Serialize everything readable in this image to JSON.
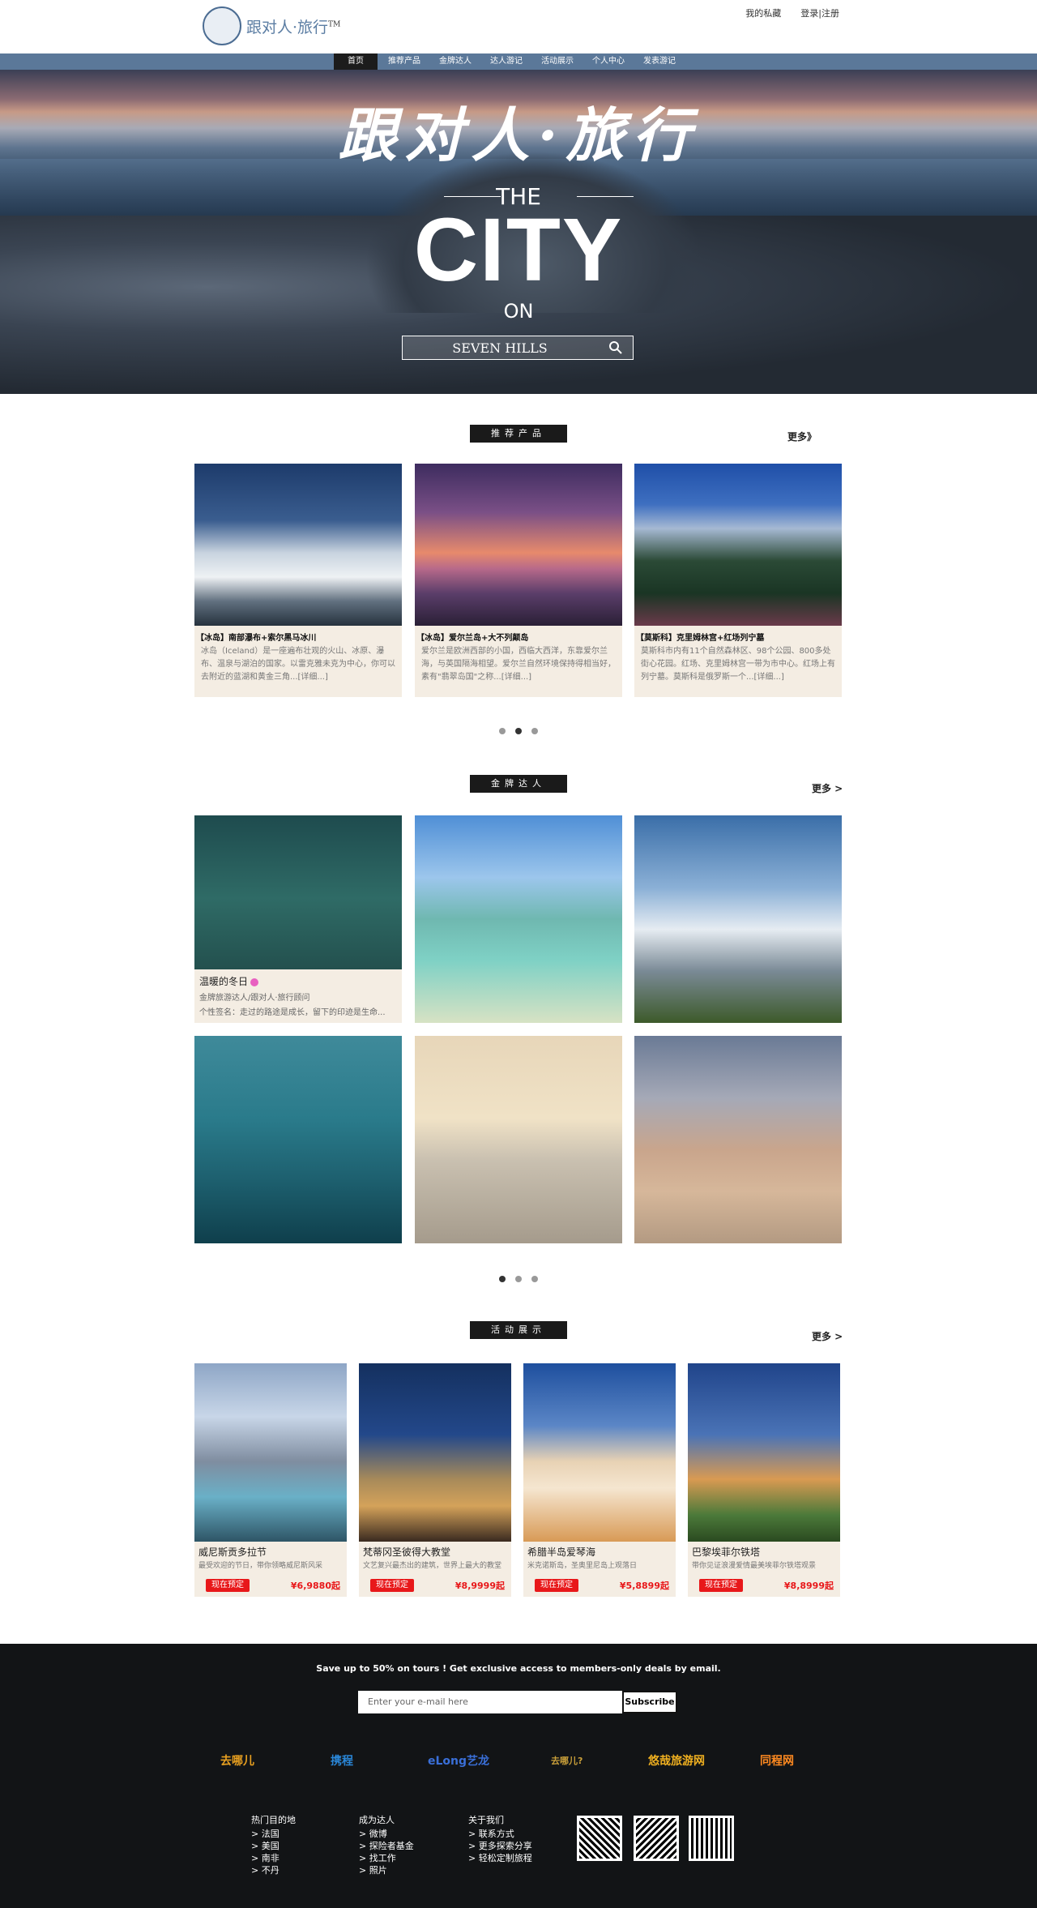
{
  "header": {
    "logo_text": "跟对人·旅行",
    "logo_tm": "TM",
    "links": [
      "我的私藏",
      "登录|注册"
    ]
  },
  "nav": [
    "首页",
    "推荐产品",
    "金牌达人",
    "达人游记",
    "活动展示",
    "个人中心",
    "发表游记"
  ],
  "hero": {
    "title": "跟对人·旅行",
    "the": "THE",
    "city": "CITY",
    "on": "ON",
    "search_text": "SEVEN HILLS"
  },
  "recommend": {
    "tag": "推荐产品",
    "more": "更多》",
    "cards": [
      {
        "title": "【冰岛】南部瀑布+索尔黑马冰川",
        "desc": "冰岛（Iceland）是一座遍布壮观的火山、冰原、瀑布、温泉与湖泊的国家。以雷克雅未克为中心，你可以去附近的蓝湖和黄金三角...[详细...]"
      },
      {
        "title": "【冰岛】爱尔兰岛+大不列颠岛",
        "desc": "爱尔兰是欧洲西部的小国，西临大西洋，东靠爱尔兰海，与英国隔海相望。爱尔兰自然环境保持得相当好，素有\"翡翠岛国\"之称...[详细...]"
      },
      {
        "title": "【莫斯科】克里姆林宫+红场列宁墓",
        "desc": "莫斯科市内有11个自然森林区、98个公园、800多处街心花园。红场、克里姆林宫一带为市中心。红场上有列宁墓。莫斯科是俄罗斯一个...[详细...]"
      }
    ]
  },
  "experts": {
    "tag": "金牌达人",
    "more": "更多 >",
    "featured": {
      "name": "温暖的冬日",
      "line1": "金牌旅游达人/跟对人·旅行顾问",
      "line2": "个性签名：走过的路途是成长，留下的印迹是生命..."
    }
  },
  "activities": {
    "tag": "活动展示",
    "more": "更多 >",
    "items": [
      {
        "title": "威尼斯贡多拉节",
        "desc": "最受欢迎的节日，带你领略威尼斯风采",
        "button": "现在预定",
        "price": "¥6,9880起"
      },
      {
        "title": "梵蒂冈圣彼得大教堂",
        "desc": "文艺复兴最杰出的建筑，世界上最大的教堂",
        "button": "现在预定",
        "price": "¥8,9999起"
      },
      {
        "title": "希腊半岛爱琴海",
        "desc": "米克诺斯岛，圣奥里尼岛上观落日",
        "button": "现在预定",
        "price": "¥5,8899起"
      },
      {
        "title": "巴黎埃菲尔铁塔",
        "desc": "带你见证浪漫爱情最美埃菲尔铁塔观景",
        "button": "现在预定",
        "price": "¥8,8999起"
      }
    ]
  },
  "footer": {
    "promo": "Save up to 50% on tours ! Get exclusive access to members-only deals by email.",
    "email_placeholder": "Enter your e-mail here",
    "subscribe": "Subscribe",
    "partners": [
      "去哪儿",
      "携程",
      "eLong艺龙",
      "去哪儿?",
      "悠哉旅游网",
      "同程网"
    ],
    "col1": {
      "title": "热门目的地",
      "items": [
        "> 法国",
        "> 美国",
        "> 南非",
        "> 不丹"
      ]
    },
    "col2": {
      "title": "成为达人",
      "items": [
        "> 微博",
        "> 探险者基金",
        "> 找工作",
        "> 照片"
      ]
    },
    "col3": {
      "title": "关于我们",
      "items": [
        "> 联系方式",
        "> 更多探索分享",
        "> 轻松定制旅程"
      ]
    }
  },
  "colors": {
    "nav_bg": "#5b7899",
    "accent_red": "#e8181a",
    "card_bg": "#f4ede3",
    "footer_bg": "#121416"
  }
}
